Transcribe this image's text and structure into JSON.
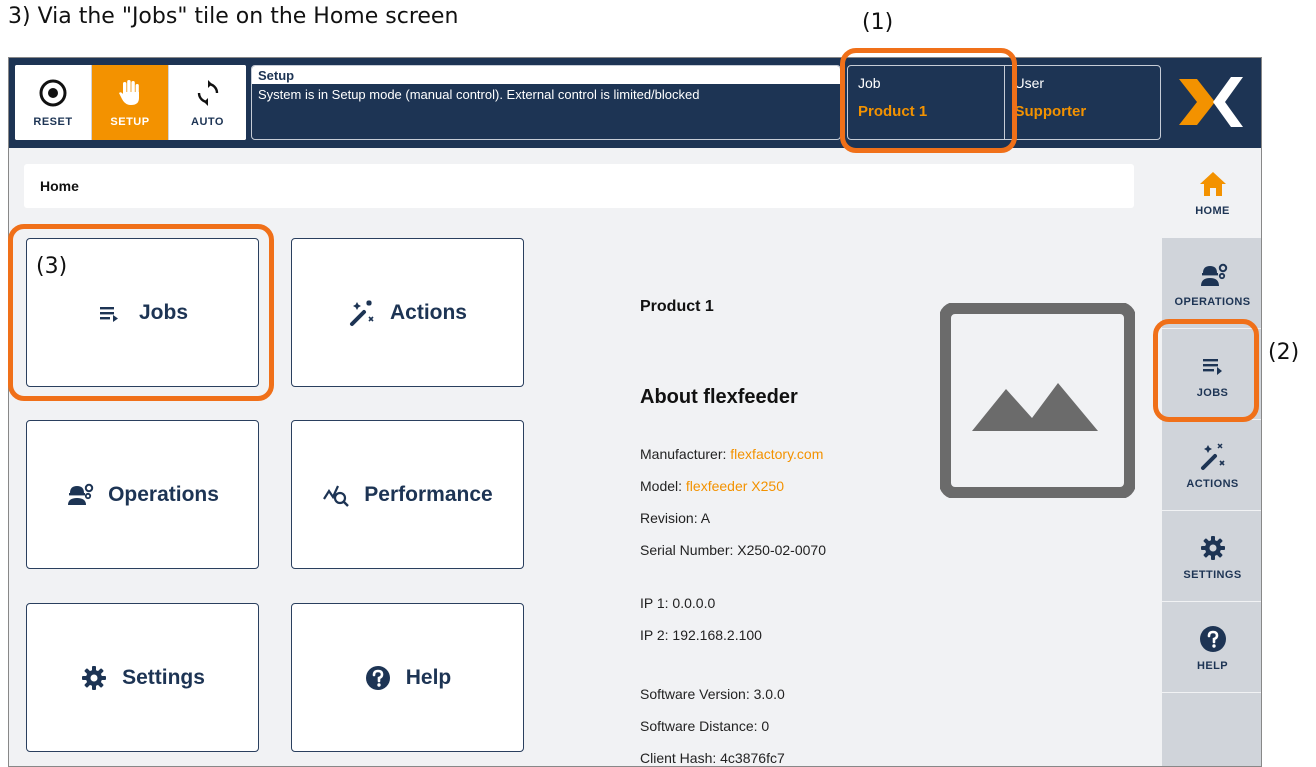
{
  "caption": "3) Via the \"Jobs\" tile on the Home screen",
  "callouts": {
    "one": "(1)",
    "two": "(2)",
    "three": "(3)"
  },
  "colors": {
    "navy": "#1d3454",
    "orange": "#f39200",
    "highlight": "#f07019"
  },
  "modes": [
    {
      "label": "RESET",
      "icon": "target-icon"
    },
    {
      "label": "SETUP",
      "icon": "hand-icon"
    },
    {
      "label": "AUTO",
      "icon": "sync-icon"
    }
  ],
  "status": {
    "title": "Setup",
    "message": "System is in Setup mode (manual control). External control is limited/blocked"
  },
  "job": {
    "label": "Job",
    "value": "Product 1"
  },
  "user": {
    "label": "User",
    "value": "Supporter"
  },
  "breadcrumb": "Home",
  "tiles": [
    {
      "label": "Jobs",
      "icon": "list-play-icon"
    },
    {
      "label": "Actions",
      "icon": "magic-wand-icon"
    },
    {
      "label": "Operations",
      "icon": "operator-gear-icon"
    },
    {
      "label": "Performance",
      "icon": "chart-search-icon"
    },
    {
      "label": "Settings",
      "icon": "gear-icon"
    },
    {
      "label": "Help",
      "icon": "question-icon"
    }
  ],
  "about": {
    "product": "Product 1",
    "heading": "About flexfeeder",
    "manufacturer_label": "Manufacturer: ",
    "manufacturer_value": "flexfactory.com",
    "model_label": "Model: ",
    "model_value": "flexfeeder X250",
    "revision": "Revision: A",
    "serial": "Serial Number: X250-02-0070",
    "ip1": "IP 1: 0.0.0.0",
    "ip2": "IP 2: 192.168.2.100",
    "software_version": "Software Version: 3.0.0",
    "software_distance": "Software Distance: 0",
    "client_hash": "Client Hash: 4c3876fc7"
  },
  "sidebar": [
    {
      "label": "HOME",
      "icon": "home-icon"
    },
    {
      "label": "OPERATIONS",
      "icon": "operator-gear-icon"
    },
    {
      "label": "JOBS",
      "icon": "list-play-icon"
    },
    {
      "label": "ACTIONS",
      "icon": "magic-wand-icon"
    },
    {
      "label": "SETTINGS",
      "icon": "gear-icon"
    },
    {
      "label": "HELP",
      "icon": "question-icon"
    }
  ]
}
